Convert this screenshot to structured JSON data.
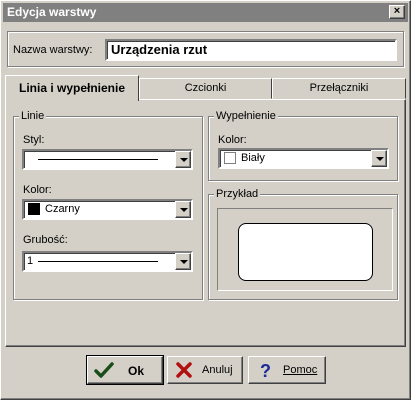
{
  "window": {
    "title": "Edycja warstwy",
    "close_glyph": "×"
  },
  "name_field": {
    "label": "Nazwa warstwy:",
    "value": "Urządzenia rzut"
  },
  "tabs": [
    {
      "label": "Linia i wypełnienie",
      "active": true
    },
    {
      "label": "Czcionki",
      "active": false
    },
    {
      "label": "Przełączniki",
      "active": false
    }
  ],
  "lines_group": {
    "title": "Linie",
    "style_label": "Styl:",
    "color_label": "Kolor:",
    "color_value": "Czarny",
    "color_swatch": "#000000",
    "width_label": "Grubość:",
    "width_value": "1"
  },
  "fill_group": {
    "title": "Wypełnienie",
    "color_label": "Kolor:",
    "color_value": "Biały",
    "color_swatch": "#ffffff"
  },
  "preview_group": {
    "title": "Przykład"
  },
  "buttons": {
    "ok": "Ok",
    "cancel": "Anuluj",
    "help": "Pomoc"
  }
}
